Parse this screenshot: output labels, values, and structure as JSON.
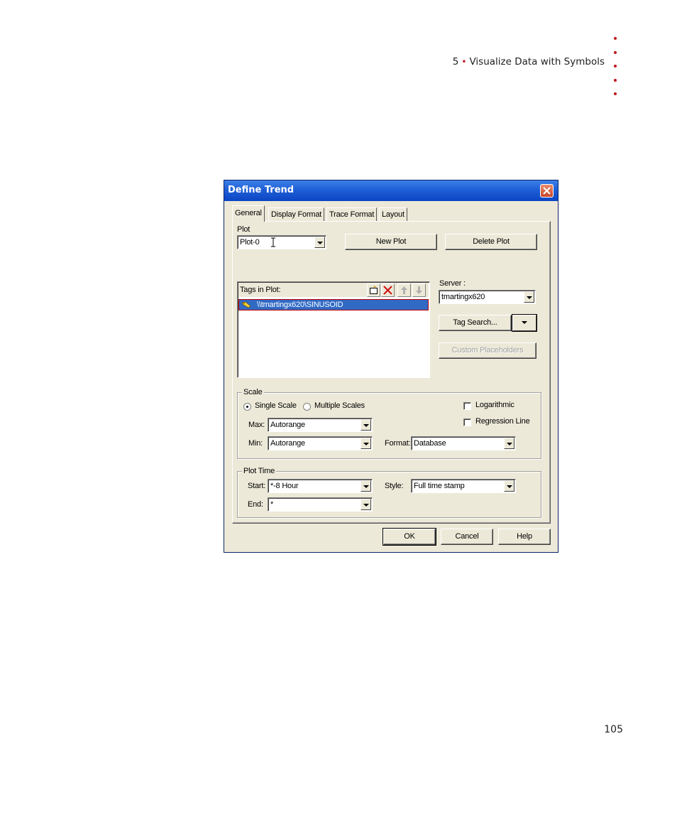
{
  "page": {
    "chapter_number": "5",
    "separator": "•",
    "chapter_title": "Visualize Data with Symbols",
    "page_number": "105",
    "accent_color": "#c0141c"
  },
  "dialog": {
    "title": "Define Trend",
    "close_icon": "close-icon",
    "tabs": [
      {
        "label": "General",
        "active": true
      },
      {
        "label": "Display Format",
        "active": false
      },
      {
        "label": "Trace Format",
        "active": false
      },
      {
        "label": "Layout",
        "active": false
      }
    ],
    "plot": {
      "label": "Plot",
      "value": "Plot-0",
      "new_button": "New Plot",
      "delete_button": "Delete Plot"
    },
    "tags": {
      "label": "Tags in Plot:",
      "toolbar_icons": [
        "new-tag-icon",
        "delete-tag-icon",
        "move-up-icon",
        "move-down-icon"
      ],
      "items": [
        {
          "label": "\\\\tmartingx620\\SINUSOID",
          "icon": "tag-icon",
          "selected": true
        }
      ]
    },
    "server": {
      "label": "Server :",
      "value": "tmartingx620",
      "tag_search_button": "Tag Search...",
      "custom_placeholders_button": "Custom Placeholders"
    },
    "scale": {
      "title": "Scale",
      "single_label": "Single Scale",
      "multiple_label": "Multiple Scales",
      "selected": "single",
      "logarithmic_label": "Logarithmic",
      "logarithmic_checked": false,
      "regression_label": "Regression Line",
      "regression_checked": false,
      "max_label": "Max:",
      "max_value": "Autorange",
      "min_label": "Min:",
      "min_value": "Autorange",
      "format_label": "Format:",
      "format_value": "Database"
    },
    "plot_time": {
      "title": "Plot Time",
      "start_label": "Start:",
      "start_value": "*-8 Hour",
      "end_label": "End:",
      "end_value": "*",
      "style_label": "Style:",
      "style_value": "Full time stamp"
    },
    "footer": {
      "ok": "OK",
      "cancel": "Cancel",
      "help": "Help"
    }
  }
}
